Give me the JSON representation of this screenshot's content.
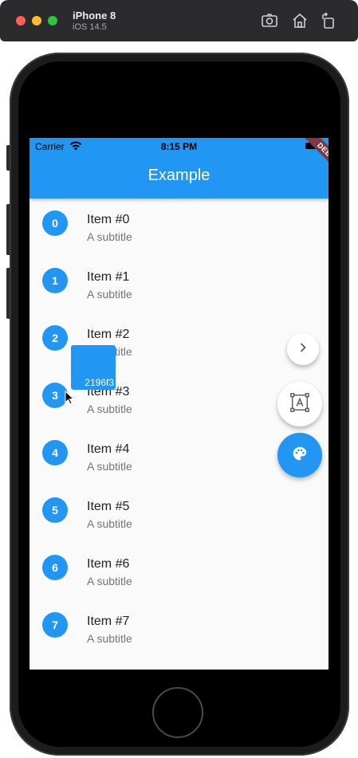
{
  "simulator": {
    "device_name": "iPhone 8",
    "os_version": "iOS 14.5",
    "toolbar_icons": [
      "screenshot-icon",
      "home-icon",
      "rotate-icon"
    ]
  },
  "status_bar": {
    "carrier": "Carrier",
    "time": "8:15 PM"
  },
  "app_bar": {
    "title": "Example",
    "debug_banner": "DEBUG",
    "color": "#2196f3"
  },
  "list": {
    "items": [
      {
        "index": "0",
        "title": "Item #0",
        "subtitle": "A subtitle"
      },
      {
        "index": "1",
        "title": "Item #1",
        "subtitle": "A subtitle"
      },
      {
        "index": "2",
        "title": "Item #2",
        "subtitle": "A subtitle"
      },
      {
        "index": "3",
        "title": "Item #3",
        "subtitle": "A subtitle"
      },
      {
        "index": "4",
        "title": "Item #4",
        "subtitle": "A subtitle"
      },
      {
        "index": "5",
        "title": "Item #5",
        "subtitle": "A subtitle"
      },
      {
        "index": "6",
        "title": "Item #6",
        "subtitle": "A subtitle"
      },
      {
        "index": "7",
        "title": "Item #7",
        "subtitle": "A subtitle"
      }
    ]
  },
  "color_picker": {
    "hex_label": "2196f3"
  },
  "fabs": {
    "next_icon": "chevron-right-icon",
    "text_icon": "text-select-icon",
    "palette_icon": "palette-icon"
  }
}
